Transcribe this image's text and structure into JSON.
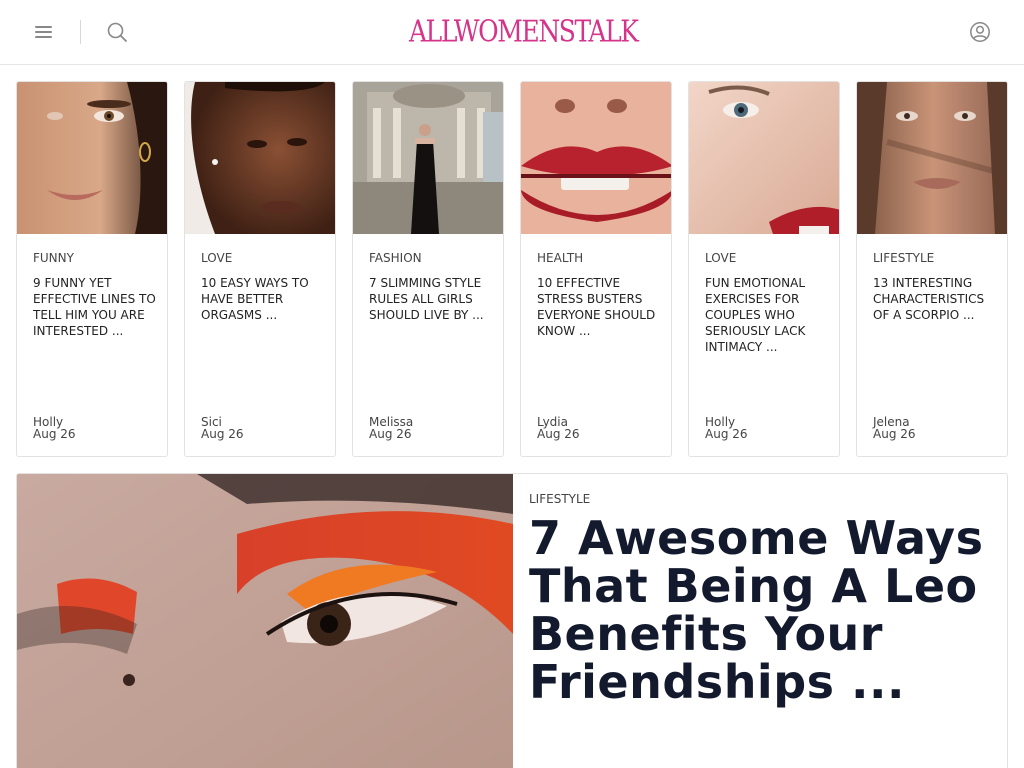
{
  "header": {
    "logo": "ALLWOMENSTALK",
    "icons": {
      "menu": "hamburger-menu-icon",
      "search": "search-icon",
      "account": "user-account-icon"
    },
    "brand_color": "#d6338a"
  },
  "cards": [
    {
      "category": "FUNNY",
      "title": "9 FUNNY YET EFFECTIVE LINES TO TELL HIM YOU ARE INTERESTED ...",
      "author": "Holly",
      "date": "Aug 26"
    },
    {
      "category": "LOVE",
      "title": "10 EASY WAYS TO HAVE BETTER ORGASMS ...",
      "author": "Sici",
      "date": "Aug 26"
    },
    {
      "category": "FASHION",
      "title": "7 SLIMMING STYLE RULES ALL GIRLS SHOULD LIVE BY ...",
      "author": "Melissa",
      "date": "Aug 26"
    },
    {
      "category": "HEALTH",
      "title": "10 EFFECTIVE STRESS BUSTERS EVERYONE SHOULD KNOW ...",
      "author": "Lydia",
      "date": "Aug 26"
    },
    {
      "category": "LOVE",
      "title": "FUN EMOTIONAL EXERCISES FOR COUPLES WHO SERIOUSLY LACK INTIMACY ...",
      "author": "Holly",
      "date": "Aug 26"
    },
    {
      "category": "LIFESTYLE",
      "title": "13 INTERESTING CHARACTERISTICS OF A SCORPIO ...",
      "author": "Jelena",
      "date": "Aug 26"
    }
  ],
  "feature": {
    "category": "LIFESTYLE",
    "title": "7 Awesome Ways That Being A Leo Benefits Your Friendships ..."
  },
  "colors": {
    "title_text": "#141a2e",
    "border": "#e2e2e2"
  }
}
